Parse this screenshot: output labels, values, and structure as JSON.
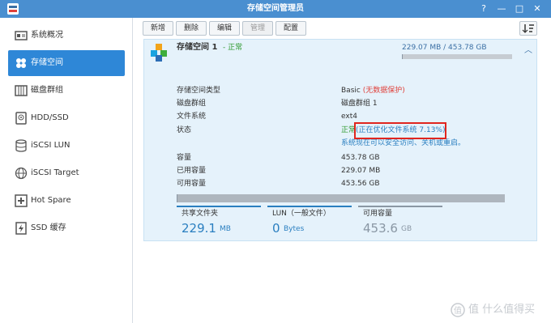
{
  "window": {
    "title": "存储空间管理员"
  },
  "sidebar": {
    "items": [
      {
        "label": "系统概况",
        "icon": "overview-icon",
        "active": false
      },
      {
        "label": "存储空间",
        "icon": "volume-icon",
        "active": true
      },
      {
        "label": "磁盘群组",
        "icon": "disk-group-icon",
        "active": false
      },
      {
        "label": "HDD/SSD",
        "icon": "hdd-icon",
        "active": false
      },
      {
        "label": "iSCSI LUN",
        "icon": "iscsi-lun-icon",
        "active": false
      },
      {
        "label": "iSCSI Target",
        "icon": "iscsi-target-icon",
        "active": false
      },
      {
        "label": "Hot Spare",
        "icon": "hot-spare-icon",
        "active": false
      },
      {
        "label": "SSD 缓存",
        "icon": "ssd-cache-icon",
        "active": false
      }
    ]
  },
  "toolbar": {
    "new_label": "新增",
    "delete_label": "删除",
    "edit_label": "编辑",
    "manage_label": "管理",
    "configure_label": "配置"
  },
  "volume": {
    "name": "存储空间 1",
    "status": "- 正常",
    "usage_text": "229.07 MB / 453.78 GB",
    "usage_fraction": 0.0005,
    "properties": {
      "type_label": "存储空间类型",
      "type_value": "Basic",
      "type_note": "(无数据保护)",
      "group_label": "磁盘群组",
      "group_value": "磁盘群组 1",
      "fs_label": "文件系统",
      "fs_value": "ext4",
      "status_label": "状态",
      "status_value": "正常",
      "status_note": "(正在优化文件系统 7.13%)",
      "status_hint": "系统现在可以安全访问、关机或重启。",
      "capacity_label": "容量",
      "capacity_value": "453.78 GB",
      "used_label": "已用容量",
      "used_value": "229.07 MB",
      "available_label": "可用容量",
      "available_value": "453.56 GB"
    },
    "stats": [
      {
        "label": "共享文件夹",
        "value": "229.1",
        "unit": "MB",
        "color": "#2a7fc0"
      },
      {
        "label": "LUN（一般文件）",
        "value": "0",
        "unit": "Bytes",
        "color": "#2a7fc0"
      },
      {
        "label": "可用容量",
        "value": "453.6",
        "unit": "GB",
        "color": "#8a97a4"
      }
    ]
  },
  "watermark": {
    "text": "值 什么值得买"
  },
  "colors": {
    "titlebar": "#4a8fd0",
    "active_nav": "#2e87d7",
    "panel_bg": "#e5f2fb",
    "ok_green": "#2e9a2e",
    "warn_red": "#e0413b",
    "link_blue": "#2a7fc0",
    "highlight_box": "#e0261f"
  }
}
